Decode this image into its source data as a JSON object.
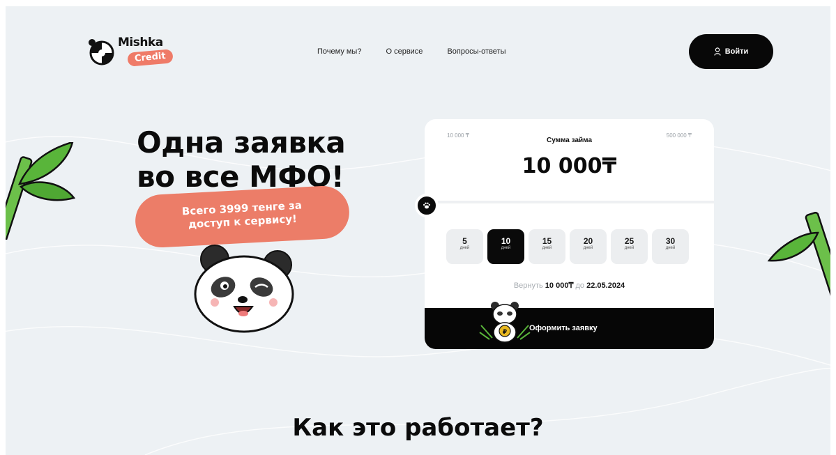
{
  "brand": {
    "name": "Mishka",
    "sub": "Credit",
    "accent_color": "#ef7b68",
    "dark_color": "#080808"
  },
  "nav": {
    "links": [
      "Почему мы?",
      "О сервисе",
      "Вопросы-ответы"
    ],
    "login_label": "Войти",
    "login_icon": "user-icon"
  },
  "hero": {
    "title_line1": "Одна заявка",
    "title_line2": "во все МФО!",
    "promo_line1": "Всего 3999 тенге за",
    "promo_line2": "доступ к сервису!"
  },
  "calculator": {
    "min_amount": "10 000 ₸",
    "max_amount": "500 000 ₸",
    "amount_label": "Сумма займа",
    "amount_value": "10 000₸",
    "slider_value": 10000,
    "slider_icon": "paw-icon",
    "terms": [
      {
        "num": "5",
        "unit": "дней"
      },
      {
        "num": "10",
        "unit": "дней"
      },
      {
        "num": "15",
        "unit": "дней"
      },
      {
        "num": "20",
        "unit": "дней"
      },
      {
        "num": "25",
        "unit": "дней"
      },
      {
        "num": "30",
        "unit": "дней"
      }
    ],
    "selected_term": "10",
    "return_prefix": "Вернуть",
    "return_amount": "10 000₸",
    "return_mid": "до",
    "return_date": "22.05.2024",
    "submit_label": "Оформить заявку"
  },
  "section": {
    "title": "Как это работает?"
  }
}
